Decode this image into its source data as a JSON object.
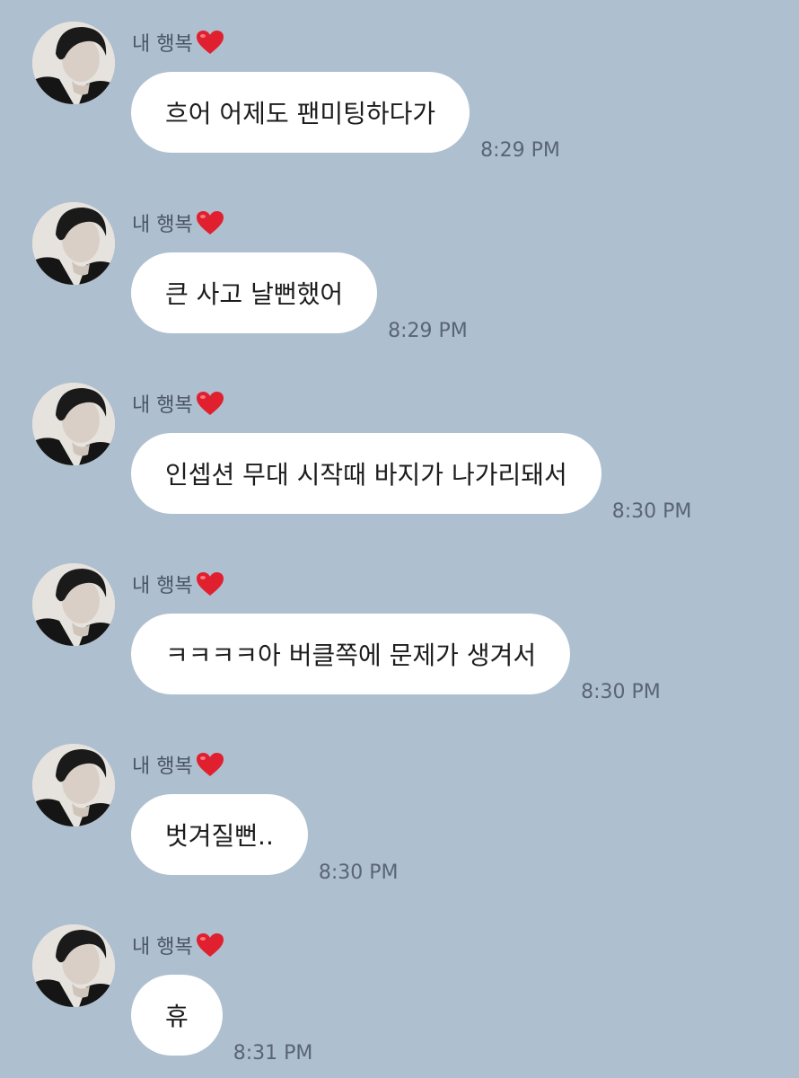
{
  "theme": {
    "background": "#aebfd0",
    "bubble": "#ffffff",
    "heart": "#e0202e"
  },
  "messages": [
    {
      "sender": "내 행복",
      "heart_icon": "red-heart-icon",
      "text": "흐어 어제도 팬미팅하다가",
      "time": "8:29 PM"
    },
    {
      "sender": "내 행복",
      "heart_icon": "red-heart-icon",
      "text": "큰 사고 날뻔했어",
      "time": "8:29 PM"
    },
    {
      "sender": "내 행복",
      "heart_icon": "red-heart-icon",
      "text": "인셉션 무대 시작때 바지가 나가리돼서",
      "time": "8:30 PM"
    },
    {
      "sender": "내 행복",
      "heart_icon": "red-heart-icon",
      "text": "ㅋㅋㅋㅋ아 버클쪽에 문제가 생겨서",
      "time": "8:30 PM"
    },
    {
      "sender": "내 행복",
      "heart_icon": "red-heart-icon",
      "text": "벗겨질뻔..",
      "time": "8:30 PM"
    },
    {
      "sender": "내 행복",
      "heart_icon": "red-heart-icon",
      "text": "휴",
      "time": "8:31 PM"
    }
  ]
}
